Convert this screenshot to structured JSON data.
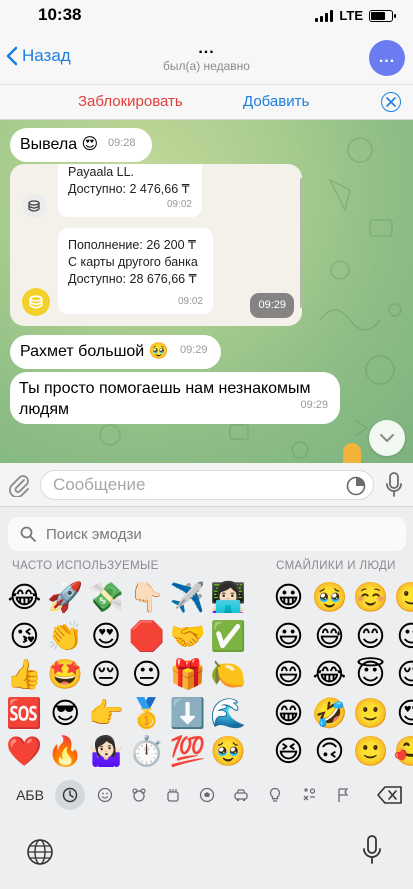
{
  "status": {
    "time": "10:38",
    "network": "LTE"
  },
  "nav": {
    "back_label": "Назад",
    "title": "...",
    "subtitle": "был(а) недавно",
    "avatar_text": "..."
  },
  "actions": {
    "block_label": "Заблокировать",
    "add_label": "Добавить"
  },
  "messages": [
    {
      "text": "Вывела 😍",
      "time": "09:28"
    },
    {
      "type": "image",
      "time": "09:29",
      "card1": {
        "line1": "Payaala LL.",
        "line2": "Доступно: 2 476,66 ₸",
        "time": "09:02"
      },
      "card2": {
        "line1": "Пополнение: 26 200 ₸",
        "line2": "С карты другого банка",
        "line3": "Доступно: 28 676,66 ₸",
        "time": "09:02"
      }
    },
    {
      "text": "Рахмет большой 🥹",
      "time": "09:29"
    },
    {
      "text": "Ты просто помогаешь нам незнакомым людям",
      "time": "09:29"
    }
  ],
  "composer": {
    "placeholder": "Сообщение"
  },
  "emoji_keyboard": {
    "search_placeholder": "Поиск эмодзи",
    "frequent_label": "ЧАСТО ИСПОЛЬЗУЕМЫЕ",
    "smileys_label": "СМАЙЛИКИ И ЛЮДИ",
    "frequent": [
      "😂",
      "🚀",
      "💸",
      "👇🏻",
      "✈️",
      "👩🏻‍💻",
      "😘",
      "👏",
      "😍",
      "🛑",
      "🤝",
      "✅",
      "👍",
      "🤩",
      "😔",
      "😐",
      "🎁",
      "🍋",
      "🆘",
      "😎",
      "👉",
      "🥇",
      "⬇️",
      "🌊",
      "❤️",
      "🔥",
      "🤷🏻‍♀️",
      "⏱️",
      "💯",
      "🥹"
    ],
    "smileys": [
      "😀",
      "🥹",
      "☺️",
      "🙂",
      "😃",
      "😅",
      "😊",
      "😉",
      "😄",
      "😂",
      "😇",
      "😌",
      "😁",
      "🤣",
      "🙂",
      "😍",
      "😆",
      "🙃",
      "🙂",
      "🥰"
    ],
    "abc_label": "АБВ",
    "categories": [
      "clock-icon",
      "smiley-icon",
      "animal-icon",
      "food-icon",
      "ball-icon",
      "car-icon",
      "bulb-icon",
      "symbols-icon",
      "flag-icon"
    ]
  }
}
